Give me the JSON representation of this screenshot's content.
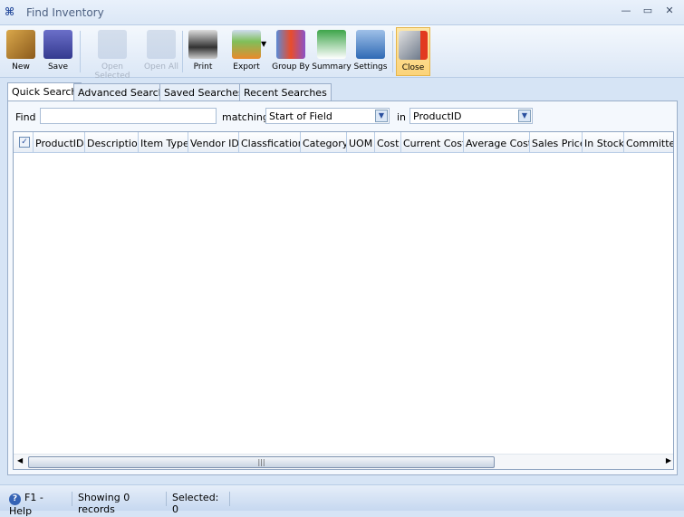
{
  "window": {
    "title": "Find Inventory"
  },
  "toolbar": [
    {
      "label": "New",
      "icon": "new-box-icon",
      "enabled": true
    },
    {
      "label": "Save",
      "icon": "floppy-icon",
      "enabled": true
    },
    {
      "label": "Open Selected",
      "icon": "open-selected-icon",
      "enabled": false
    },
    {
      "label": "Open All",
      "icon": "open-all-icon",
      "enabled": false
    },
    {
      "label": "Print",
      "icon": "printer-icon",
      "enabled": true
    },
    {
      "label": "Export",
      "icon": "export-icon",
      "enabled": true
    },
    {
      "label": "Group By",
      "icon": "group-by-icon",
      "enabled": true
    },
    {
      "label": "Summary",
      "icon": "summary-icon",
      "enabled": true
    },
    {
      "label": "Settings",
      "icon": "settings-icon",
      "enabled": true
    },
    {
      "label": "Close",
      "icon": "close-window-icon",
      "enabled": true
    }
  ],
  "tabs": [
    "Quick Search",
    "Advanced Search",
    "Saved Searches",
    "Recent Searches"
  ],
  "search": {
    "find_label": "Find",
    "find_value": "",
    "matching_label": "matching",
    "matching_value": "Start of Field",
    "in_label": "in",
    "in_value": "ProductID"
  },
  "grid": {
    "columns": [
      "ProductID",
      "Description",
      "Item Type",
      "Vendor ID",
      "Classfication",
      "Category",
      "UOM",
      "Cost",
      "Current Cost",
      "Average Cost",
      "Sales Price",
      "In Stock",
      "Committed"
    ],
    "rows": []
  },
  "status": {
    "help": "F1 - Help",
    "records": "Showing 0 records",
    "selected": "Selected: 0"
  },
  "colors": {
    "accent": "#3563b5",
    "close_highlight": "#fbd37a"
  }
}
